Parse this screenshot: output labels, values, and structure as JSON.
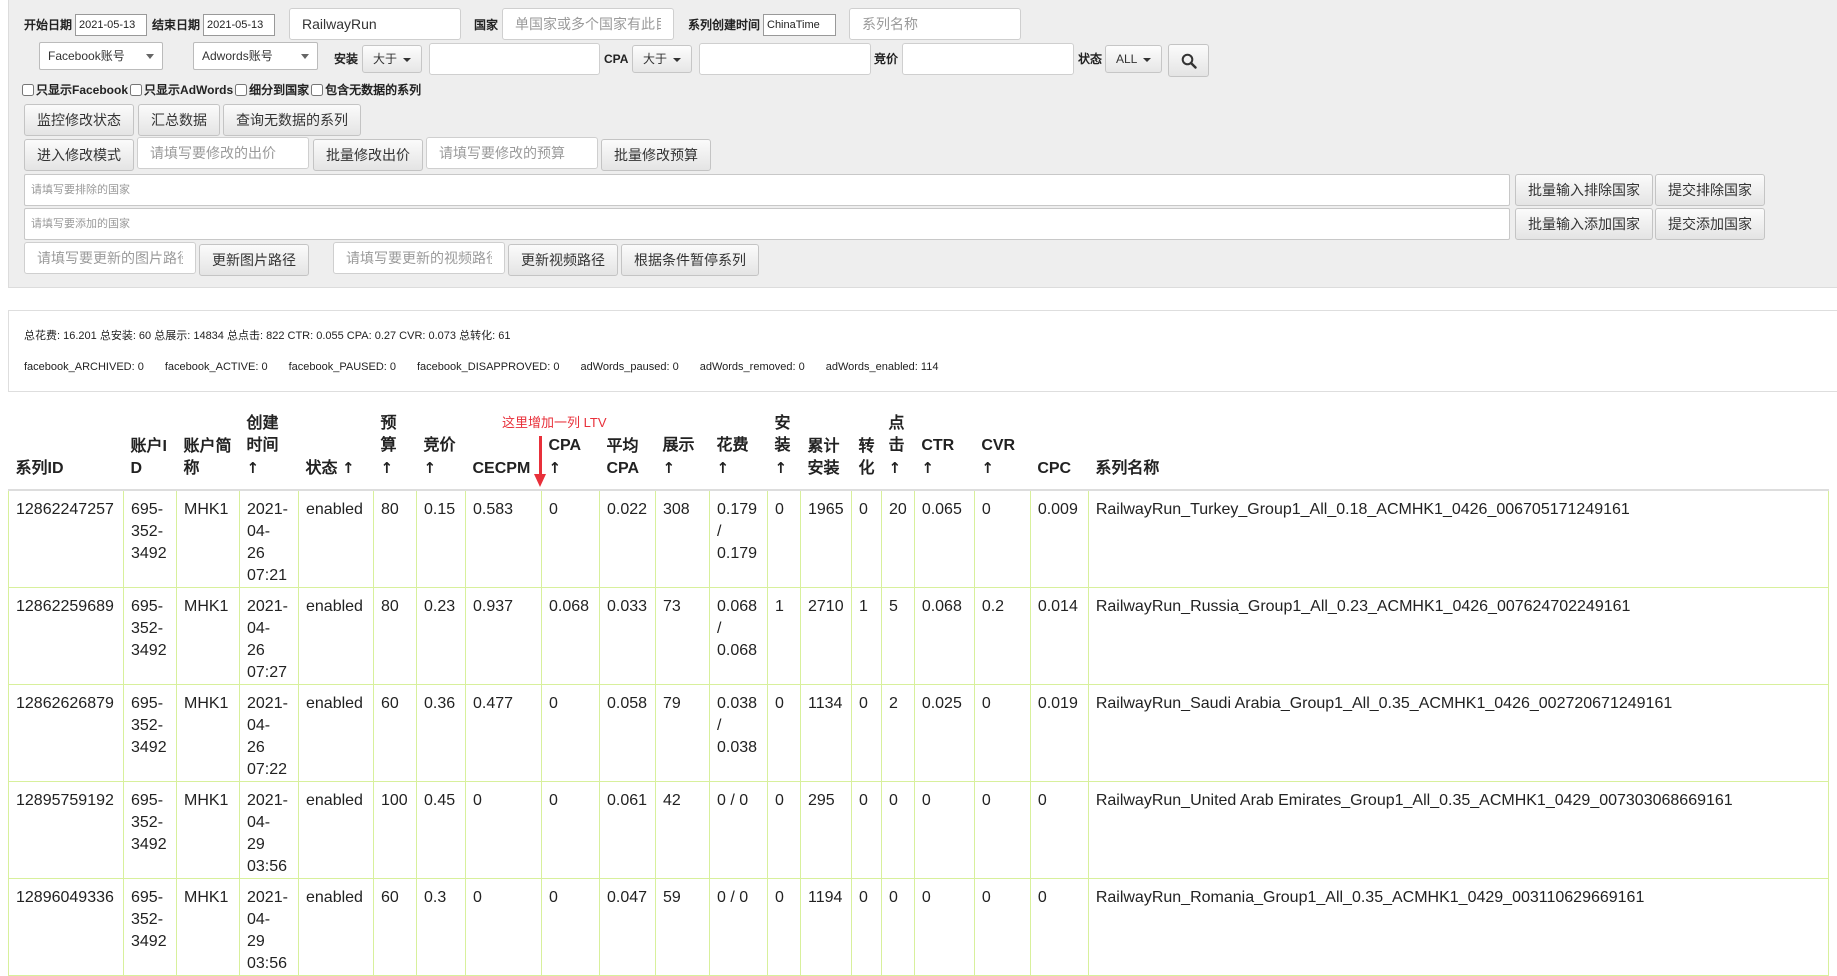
{
  "filters": {
    "start_date_label": "开始日期",
    "start_date_value": "2021-05-13",
    "end_date_label": "结束日期",
    "end_date_value": "2021-05-13",
    "app_value": "RailwayRun",
    "country_label": "国家",
    "country_placeholder": "单国家或多个国家有此目",
    "created_time_label": "系列创建时间",
    "created_time_value": "ChinaTime",
    "campaign_name_placeholder": "系列名称",
    "facebook_account": "Facebook账号",
    "adwords_account": "Adwords账号",
    "install_label": "安装",
    "install_op": "大于",
    "cpa_label": "CPA",
    "cpa_op": "大于",
    "bid_label": "竞价",
    "status_label": "状态",
    "status_value": "ALL"
  },
  "checkboxes": [
    "只显示Facebook",
    "只显示AdWords",
    "细分到国家",
    "包含无数据的系列"
  ],
  "buttons": {
    "monitor": "监控修改状态",
    "summary": "汇总数据",
    "query_no_data": "查询无数据的系列",
    "edit_mode": "进入修改模式",
    "bid_placeholder": "请填写要修改的出价",
    "batch_bid": "批量修改出价",
    "budget_placeholder": "请填写要修改的预算",
    "batch_budget": "批量修改预算",
    "exclude_placeholder": "请填写要排除的国家",
    "batch_exclude": "批量输入排除国家",
    "submit_exclude": "提交排除国家",
    "add_placeholder": "请填写要添加的国家",
    "batch_add": "批量输入添加国家",
    "submit_add": "提交添加国家",
    "image_placeholder": "请填写要更新的图片路径",
    "update_image": "更新图片路径",
    "video_placeholder": "请填写要更新的视频路径",
    "update_video": "更新视频路径",
    "pause_by_condition": "根据条件暂停系列"
  },
  "summary": {
    "totals": "总花费: 16.201 总安装: 60 总展示: 14834 总点击: 822 CTR: 0.055 CPA: 0.27 CVR: 0.073 总转化: 61",
    "statuses": [
      "facebook_ARCHIVED: 0",
      "facebook_ACTIVE: 0",
      "facebook_PAUSED: 0",
      "facebook_DISAPPROVED: 0",
      "adWords_paused: 0",
      "adWords_removed: 0",
      "adWords_enabled: 114"
    ]
  },
  "annotation": "这里增加一列 LTV",
  "table": {
    "headers": [
      {
        "text": "系列ID",
        "sort": false,
        "w": 115
      },
      {
        "text": "账户ID",
        "sort": false,
        "w": 53
      },
      {
        "text": "账户简称",
        "sort": false,
        "w": 63
      },
      {
        "text": "创建时间",
        "sort": true,
        "w": 59
      },
      {
        "text": "状态",
        "sort": true,
        "w": 75
      },
      {
        "text": "预算",
        "sort": true,
        "w": 43
      },
      {
        "text": "竞价",
        "sort": true,
        "w": 49
      },
      {
        "text": "CECPM",
        "sort": false,
        "w": 76
      },
      {
        "text": "CPA",
        "sort": true,
        "w": 58
      },
      {
        "text": "平均CPA",
        "sort": false,
        "w": 56
      },
      {
        "text": "展示",
        "sort": true,
        "w": 54
      },
      {
        "text": "花费",
        "sort": true,
        "w": 58
      },
      {
        "text": "安装",
        "sort": true,
        "w": 33
      },
      {
        "text": "累计安装",
        "sort": false,
        "w": 51
      },
      {
        "text": "转化",
        "sort": false,
        "w": 30
      },
      {
        "text": "点击",
        "sort": true,
        "w": 30
      },
      {
        "text": "CTR",
        "sort": true,
        "w": 60
      },
      {
        "text": "CVR",
        "sort": true,
        "w": 56
      },
      {
        "text": "CPC",
        "sort": false,
        "w": 58
      },
      {
        "text": "系列名称",
        "sort": false,
        "w": 740
      }
    ],
    "rows": [
      [
        "12862247257",
        "695-352-3492",
        "MHK1",
        "2021-04-26 07:21",
        "enabled",
        "80",
        "0.15",
        "0.583",
        "0",
        "0.022",
        "308",
        "0.179 / 0.179",
        "0",
        "1965",
        "0",
        "20",
        "0.065",
        "0",
        "0.009",
        "RailwayRun_Turkey_Group1_All_0.18_ACMHK1_0426_006705171249161"
      ],
      [
        "12862259689",
        "695-352-3492",
        "MHK1",
        "2021-04-26 07:27",
        "enabled",
        "80",
        "0.23",
        "0.937",
        "0.068",
        "0.033",
        "73",
        "0.068 / 0.068",
        "1",
        "2710",
        "1",
        "5",
        "0.068",
        "0.2",
        "0.014",
        "RailwayRun_Russia_Group1_All_0.23_ACMHK1_0426_007624702249161"
      ],
      [
        "12862626879",
        "695-352-3492",
        "MHK1",
        "2021-04-26 07:22",
        "enabled",
        "60",
        "0.36",
        "0.477",
        "0",
        "0.058",
        "79",
        "0.038 / 0.038",
        "0",
        "1134",
        "0",
        "2",
        "0.025",
        "0",
        "0.019",
        "RailwayRun_Saudi Arabia_Group1_All_0.35_ACMHK1_0426_002720671249161"
      ],
      [
        "12895759192",
        "695-352-3492",
        "MHK1",
        "2021-04-29 03:56",
        "enabled",
        "100",
        "0.45",
        "0",
        "0",
        "0.061",
        "42",
        "0 / 0",
        "0",
        "295",
        "0",
        "0",
        "0",
        "0",
        "0",
        "RailwayRun_United Arab Emirates_Group1_All_0.35_ACMHK1_0429_007303068669161"
      ],
      [
        "12896049336",
        "695-352-3492",
        "MHK1",
        "2021-04-29 03:56",
        "enabled",
        "60",
        "0.3",
        "0",
        "0",
        "0.047",
        "59",
        "0 / 0",
        "0",
        "1194",
        "0",
        "0",
        "0",
        "0",
        "0",
        "RailwayRun_Romania_Group1_All_0.35_ACMHK1_0429_003110629669161"
      ]
    ]
  }
}
